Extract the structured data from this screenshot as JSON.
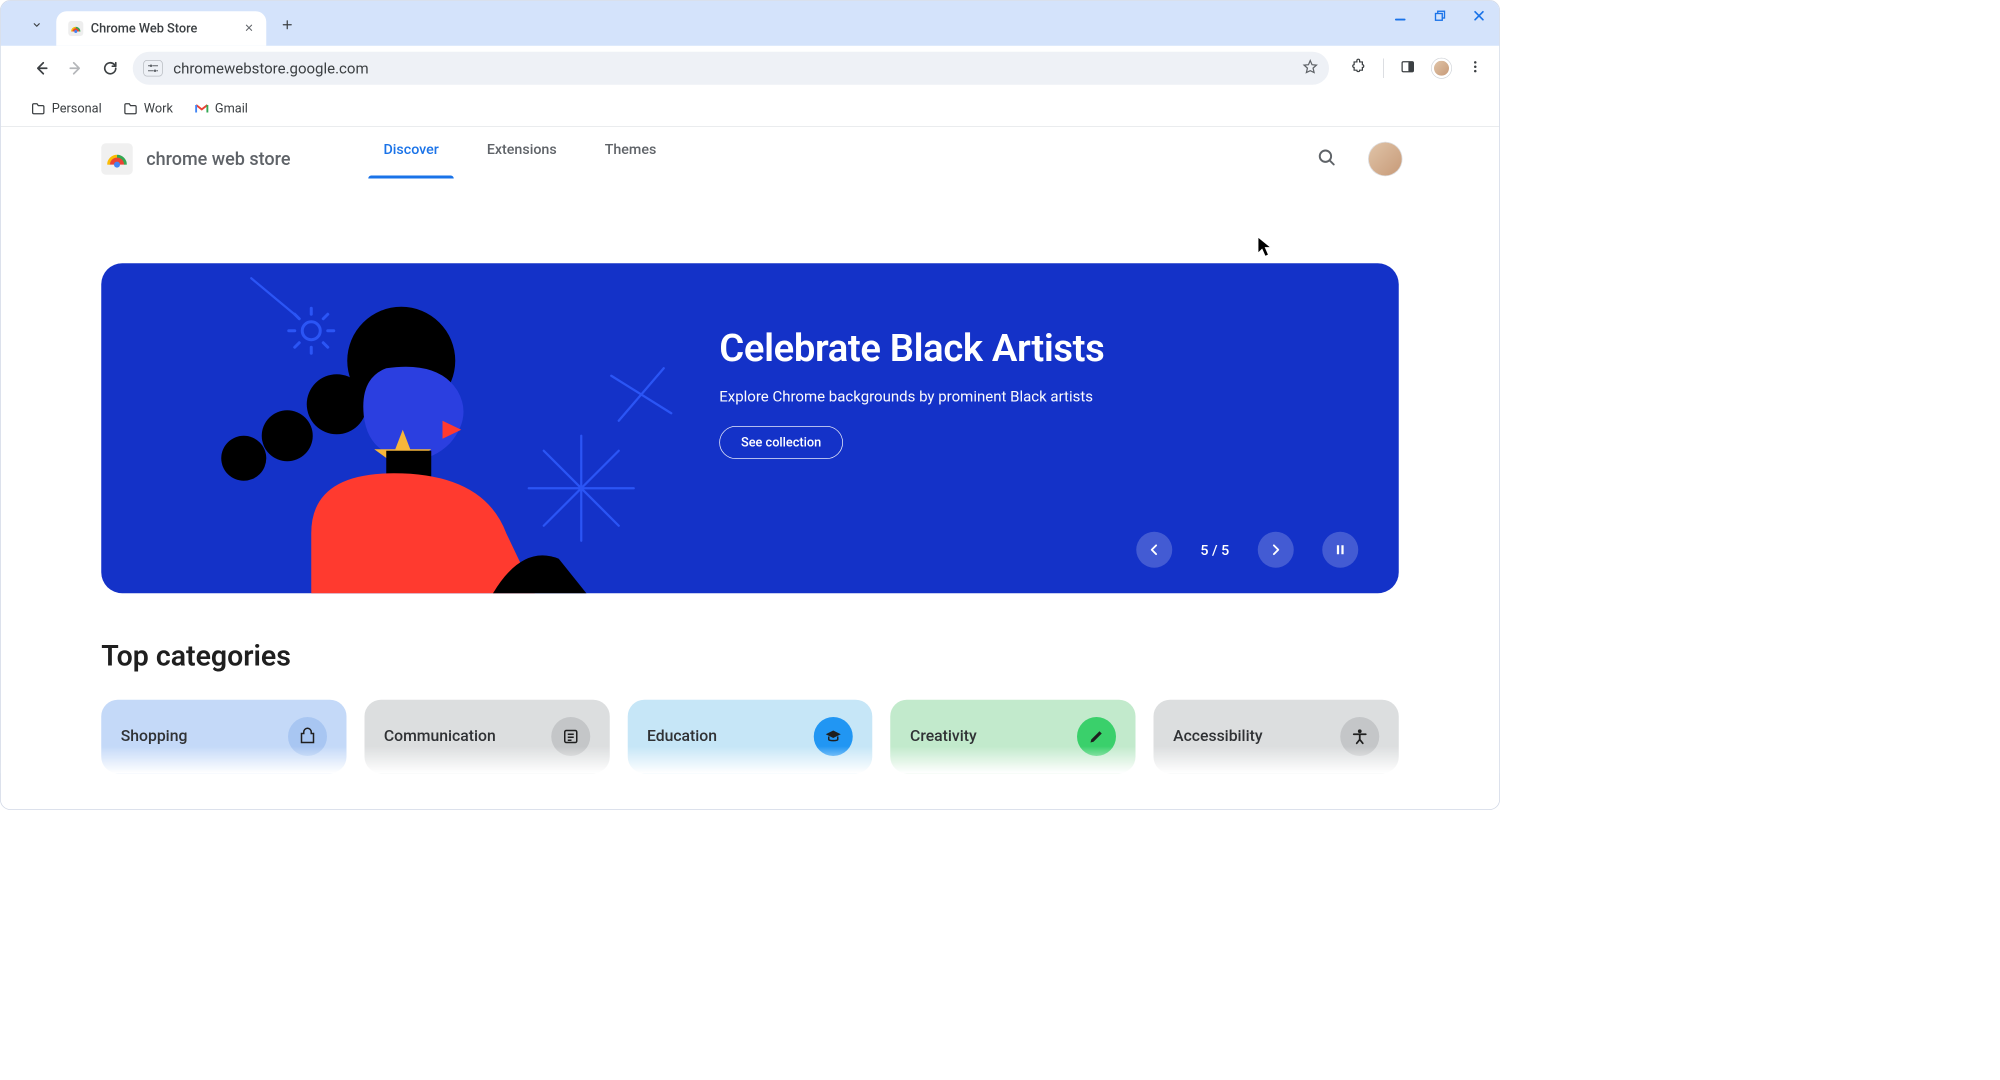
{
  "browser": {
    "tab_title": "Chrome Web Store",
    "url": "chromewebstore.google.com",
    "bookmarks": [
      "Personal",
      "Work",
      "Gmail"
    ]
  },
  "header": {
    "brand": "chrome web store",
    "tabs": [
      {
        "label": "Discover",
        "active": true
      },
      {
        "label": "Extensions",
        "active": false
      },
      {
        "label": "Themes",
        "active": false
      }
    ]
  },
  "hero": {
    "title": "Celebrate Black Artists",
    "subtitle": "Explore Chrome backgrounds by prominent Black artists",
    "cta": "See collection",
    "position": "5 / 5"
  },
  "sections": {
    "top_categories_title": "Top categories",
    "categories": [
      {
        "label": "Shopping",
        "bg": "#c4d9f8",
        "chip": "#a8c6f2",
        "icon": "bag"
      },
      {
        "label": "Communication",
        "bg": "#dcdedf",
        "chip": "#c4c6c8",
        "icon": "news"
      },
      {
        "label": "Education",
        "bg": "#c6e6f7",
        "chip": "#2196f3",
        "icon": "grad"
      },
      {
        "label": "Creativity",
        "bg": "#c2eacc",
        "chip": "#3ad06b",
        "icon": "pen"
      },
      {
        "label": "Accessibility",
        "bg": "#dcdedf",
        "chip": "#c4c6c8",
        "icon": "a11y"
      }
    ]
  },
  "colors": {
    "blue": "#1a73e8",
    "hero": "#1432c8"
  }
}
